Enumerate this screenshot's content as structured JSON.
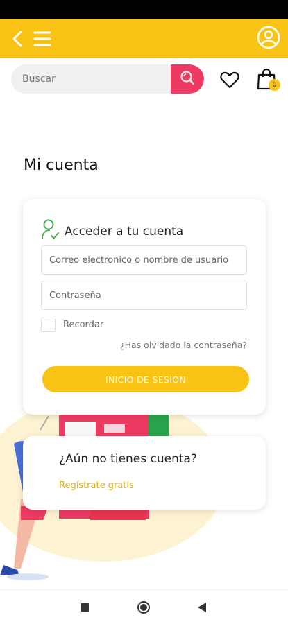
{
  "search": {
    "placeholder": "Buscar"
  },
  "cart": {
    "count": "0"
  },
  "page": {
    "title": "Mi cuenta"
  },
  "login": {
    "heading": "Acceder a tu cuenta",
    "email_placeholder": "Correo electronico o nombre de usuario",
    "password_placeholder": "Contraseña",
    "remember_label": "Recordar",
    "forgot_link": "¿Has olvidado la contraseña?",
    "submit_label": "INICIO DE SESION"
  },
  "signup": {
    "question": "¿Aún no tienes cuenta?",
    "link": "Regístrate gratis"
  },
  "colors": {
    "accent": "#f9c316",
    "search_button": "#ec3a62",
    "link_yellow": "#e6b100"
  }
}
